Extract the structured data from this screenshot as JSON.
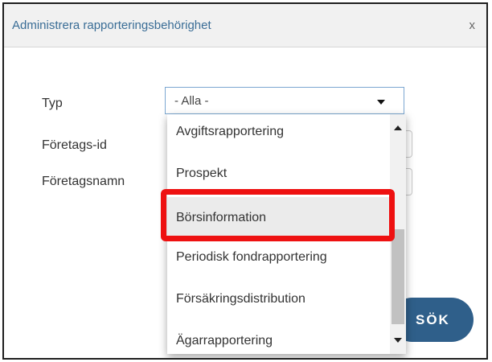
{
  "dialog": {
    "title": "Administrera rapporteringsbehörighet",
    "close_label": "x"
  },
  "form": {
    "type_label": "Typ",
    "type_selected": "- Alla -",
    "company_id_label": "Företags-id",
    "company_name_label": "Företagsnamn"
  },
  "dropdown": {
    "items": [
      "Avgiftsrapportering",
      "Prospekt",
      "Börsinformation",
      "Periodisk fondrapportering",
      "Försäkringsdistribution",
      "Ägarrapportering"
    ],
    "highlighted_item": "Börsinformation"
  },
  "actions": {
    "search_label": "SÖK"
  },
  "colors": {
    "accent": "#2f5f8a",
    "title_text": "#3a6d96",
    "annotation": "#ee1111"
  }
}
